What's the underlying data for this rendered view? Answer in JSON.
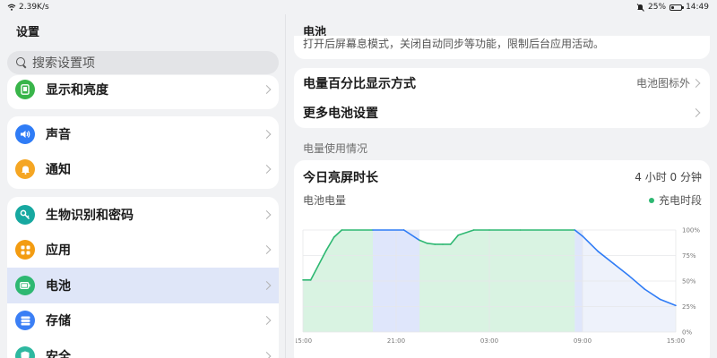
{
  "status_bar": {
    "network_speed": "2.39K/s",
    "battery_percent": "25%",
    "battery_level": 0.25,
    "time": "14:49"
  },
  "left_panel": {
    "title": "设置",
    "search_placeholder": "搜索设置项",
    "items": [
      {
        "label": "显示和亮度",
        "icon": "display-icon",
        "color": "#39b54a"
      },
      {
        "label": "声音",
        "icon": "volume-icon",
        "color": "#2f7cf6"
      },
      {
        "label": "通知",
        "icon": "bell-icon",
        "color": "#f5a623"
      },
      {
        "label": "生物识别和密码",
        "icon": "key-icon",
        "color": "#17a8a0"
      },
      {
        "label": "应用",
        "icon": "apps-icon",
        "color": "#f39c12"
      },
      {
        "label": "电池",
        "icon": "battery-icon",
        "color": "#2eb872",
        "selected": true
      },
      {
        "label": "存储",
        "icon": "storage-icon",
        "color": "#3b7ff5"
      },
      {
        "label": "安全",
        "icon": "shield-icon",
        "color": "#2eb8a0"
      }
    ]
  },
  "right_panel": {
    "title": "电池",
    "clipped_text": "打开后屏幕息模式，关闭自动同步等功能，限制后台应用活动。",
    "rows": [
      {
        "label": "电量百分比显示方式",
        "value": "电池图标外"
      },
      {
        "label": "更多电池设置",
        "value": ""
      }
    ],
    "section_label": "电量使用情况",
    "usage": {
      "title": "今日亮屏时长",
      "duration": "4 小时 0 分钟",
      "chart_label": "电池电量",
      "legend": "充电时段"
    }
  },
  "chart_data": {
    "type": "area",
    "x_ticks": [
      "15:00",
      "21:00",
      "03:00",
      "09:00",
      "15:00"
    ],
    "y_ticks": [
      "100%",
      "75%",
      "50%",
      "25%",
      "0%"
    ],
    "ylim": [
      0,
      100
    ],
    "series": [
      {
        "x_hours": [
          0,
          0.5,
          1.5,
          2,
          2.5,
          4.5,
          6.5,
          7.5,
          8,
          8.5,
          9,
          9.5,
          10,
          11,
          12,
          14,
          17.5,
          18,
          19,
          20,
          21,
          22,
          23,
          24
        ],
        "values": [
          51,
          51,
          80,
          93,
          100,
          100,
          100,
          90,
          87,
          86,
          86,
          86,
          95,
          100,
          100,
          100,
          100,
          94,
          79,
          67,
          55,
          42,
          32,
          26
        ]
      }
    ],
    "charging_periods": [
      [
        0,
        4.5
      ],
      [
        7.5,
        17.5
      ]
    ],
    "screen_on_periods": [
      [
        4.5,
        7.5
      ],
      [
        17.5,
        18
      ]
    ],
    "colors": {
      "line_charging": "#2eb872",
      "line_discharging": "#2f7cf6",
      "fill_charging": "#d9f3e2",
      "fill_screen": "#dce4fa"
    }
  }
}
